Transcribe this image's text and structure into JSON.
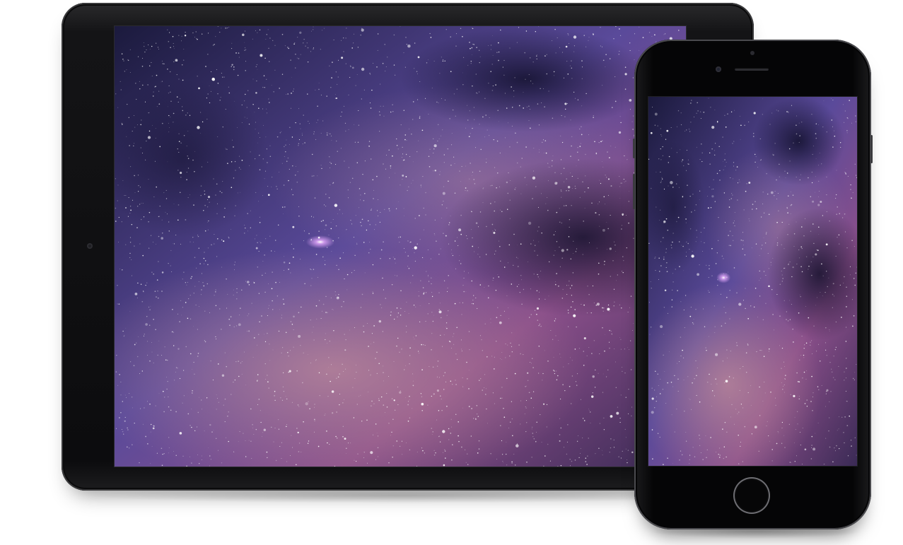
{
  "scene": {
    "devices": [
      {
        "kind": "tablet",
        "orientation": "landscape",
        "color": "#111113"
      },
      {
        "kind": "phone",
        "orientation": "portrait",
        "color": "#050506"
      }
    ],
    "wallpaper": {
      "subject": "milky-way-starfield",
      "colors": {
        "deep": "#1b1a3d",
        "violet": "#5a4a9a",
        "magenta": "#8a4f8a",
        "pink_glow": "#c08c9a",
        "star": "#ffffff",
        "nebula_core": "#d49cf0"
      }
    }
  }
}
